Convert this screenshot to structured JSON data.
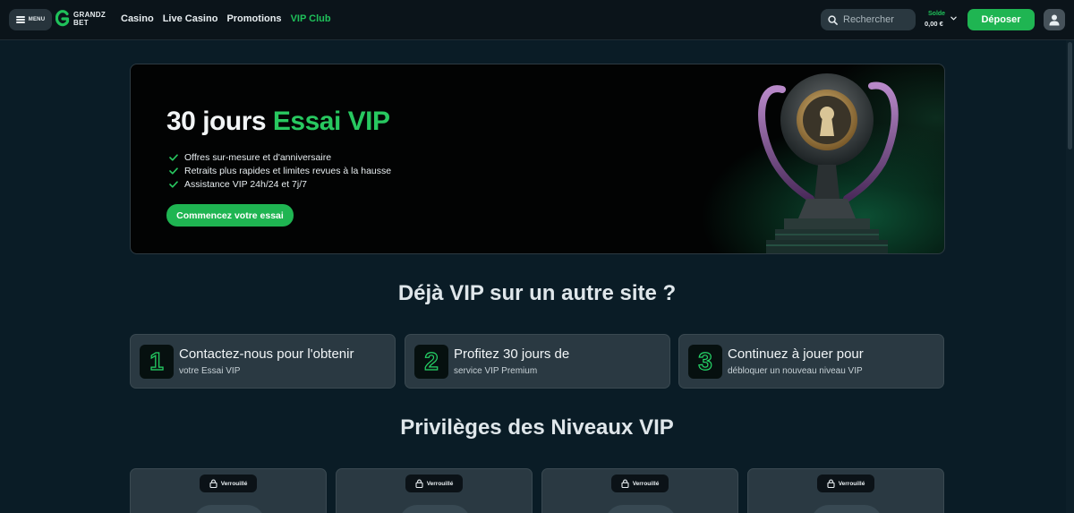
{
  "header": {
    "menu_label": "MENU",
    "logo_top": "GRANDZ",
    "logo_bottom": "BET",
    "nav": [
      {
        "label": "Casino"
      },
      {
        "label": "Live Casino"
      },
      {
        "label": "Promotions"
      },
      {
        "label": "VIP Club",
        "active": true
      }
    ],
    "search_placeholder": "Rechercher",
    "balance_label": "Solde",
    "balance_value": "0,00 €",
    "deposit_label": "Déposer"
  },
  "hero": {
    "title_white": "30 jours",
    "title_green": "Essai VIP",
    "perks": [
      "Offres sur-mesure et d'anniversaire",
      "Retraits plus rapides et limites revues à la hausse",
      "Assistance VIP 24h/24 et 7j/7"
    ],
    "cta_label": "Commencez votre essai"
  },
  "vip_elsewhere": {
    "title": "Déjà VIP sur un autre site ?",
    "steps": [
      {
        "number": "1",
        "title": "Contactez-nous pour l'obtenir",
        "subtitle": "votre Essai VIP"
      },
      {
        "number": "2",
        "title": "Profitez 30 jours de",
        "subtitle": "service VIP Premium"
      },
      {
        "number": "3",
        "title": "Continuez à jouer pour",
        "subtitle": "débloquer un nouveau niveau VIP"
      }
    ]
  },
  "tiers": {
    "title": "Privilèges des Niveaux VIP",
    "cards": [
      {
        "status": "Verrouillé"
      },
      {
        "status": "Verrouillé"
      },
      {
        "status": "Verrouillé"
      },
      {
        "status": "Verrouillé"
      }
    ]
  },
  "colors": {
    "accent_green": "#1fb552",
    "background": "#0a1c26",
    "card": "#2a3942"
  },
  "icons": {
    "menu": "hamburger-icon",
    "search": "search-icon",
    "balance_toggle": "chevron-down-icon",
    "profile": "user-icon",
    "perk": "check-icon",
    "tier_lock": "lock-icon"
  }
}
